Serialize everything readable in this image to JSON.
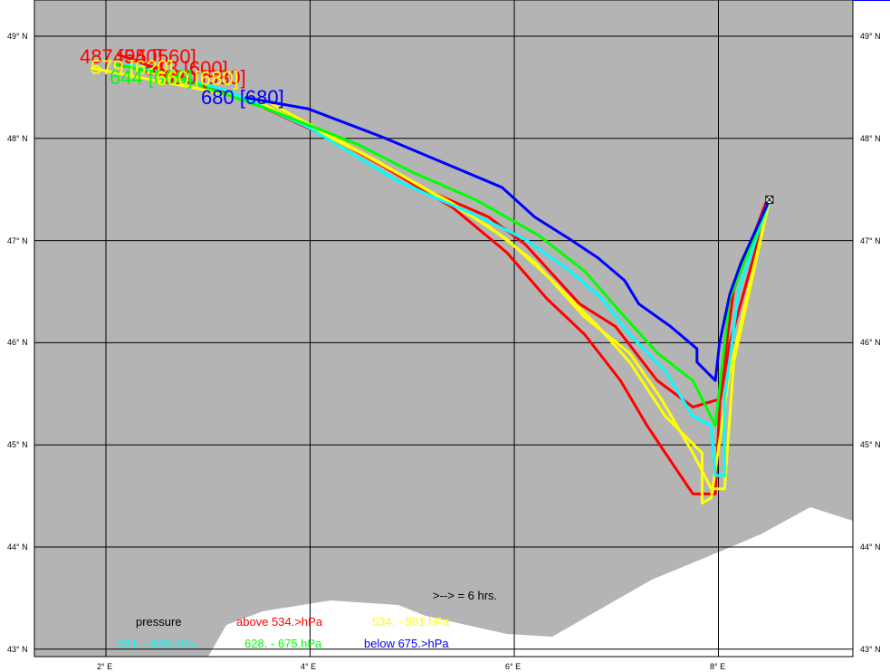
{
  "colors": {
    "ocean": "#b4b4b4",
    "land": "#ffffff",
    "red": "#ff0000",
    "yellow": "#ffff00",
    "green": "#00ff00",
    "cyan": "#00ffff",
    "blue": "#0000ff"
  },
  "axes": {
    "lat_labels": [
      "49° N",
      "48° N",
      "47° N",
      "46° N",
      "45° N",
      "44° N",
      "43° N"
    ],
    "lon_labels": [
      "2° E",
      "4° E",
      "6° E",
      "8° E"
    ]
  },
  "source": {
    "lon": 8.5,
    "lat": 47.4
  },
  "trajectory_labels": [
    "487 [540]",
    "495 [560]",
    "513 [600]",
    "579 [620]",
    "620 [580]",
    "644 [660]",
    "660 [680]",
    "680 [680]"
  ],
  "legend": {
    "time_step": ">--> =  6 hrs.",
    "pressure_title": "pressure",
    "red": "above   534.>hPa",
    "yellow": "534. -    581.hPa",
    "cyan": "581. -    628.hPa",
    "green": "628. -    675.hPa",
    "blue": "below   675.>hPa"
  },
  "trajectories": [
    {
      "color": "red",
      "points": [
        [
          8.5,
          47.4
        ],
        [
          8.46,
          47.36
        ],
        [
          8.15,
          46.52
        ],
        [
          8.02,
          45.54
        ],
        [
          7.97,
          44.52
        ],
        [
          7.75,
          44.52
        ],
        [
          7.48,
          44.92
        ],
        [
          7.3,
          45.19
        ],
        [
          7.04,
          45.63
        ],
        [
          6.69,
          46.08
        ],
        [
          6.32,
          46.43
        ],
        [
          5.93,
          46.88
        ],
        [
          5.4,
          47.32
        ],
        [
          4.51,
          47.85
        ],
        [
          3.62,
          48.29
        ],
        [
          2.12,
          48.82
        ]
      ]
    },
    {
      "color": "red",
      "points": [
        [
          8.5,
          47.4
        ],
        [
          8.11,
          45.99
        ],
        [
          8.02,
          45.45
        ],
        [
          7.75,
          45.37
        ],
        [
          7.4,
          45.63
        ],
        [
          6.99,
          46.16
        ],
        [
          6.64,
          46.38
        ],
        [
          6.11,
          46.96
        ],
        [
          5.75,
          47.23
        ],
        [
          5.13,
          47.5
        ],
        [
          4.33,
          47.94
        ],
        [
          3.18,
          48.47
        ]
      ]
    },
    {
      "color": "yellow",
      "points": [
        [
          8.5,
          47.4
        ],
        [
          8.11,
          45.72
        ],
        [
          7.93,
          44.48
        ],
        [
          7.84,
          44.43
        ],
        [
          7.84,
          44.92
        ],
        [
          7.48,
          45.28
        ],
        [
          7.13,
          45.81
        ],
        [
          6.82,
          46.16
        ],
        [
          6.37,
          46.61
        ],
        [
          5.93,
          47.01
        ],
        [
          5.4,
          47.36
        ],
        [
          4.51,
          47.85
        ],
        [
          3.45,
          48.38
        ],
        [
          1.85,
          48.69
        ]
      ]
    },
    {
      "color": "yellow",
      "points": [
        [
          8.5,
          47.4
        ],
        [
          8.15,
          45.81
        ],
        [
          8.06,
          44.57
        ],
        [
          7.93,
          44.57
        ],
        [
          7.75,
          44.92
        ],
        [
          7.44,
          45.45
        ],
        [
          7.13,
          45.9
        ],
        [
          6.69,
          46.25
        ],
        [
          6.2,
          46.79
        ],
        [
          5.75,
          47.14
        ],
        [
          4.69,
          47.76
        ],
        [
          3.62,
          48.34
        ]
      ]
    },
    {
      "color": "cyan",
      "points": [
        [
          8.5,
          47.4
        ],
        [
          8.2,
          46.52
        ],
        [
          8.06,
          45.45
        ],
        [
          8.06,
          44.7
        ],
        [
          7.97,
          44.7
        ],
        [
          7.93,
          45.19
        ],
        [
          7.75,
          45.28
        ],
        [
          7.48,
          45.72
        ],
        [
          7.13,
          46.08
        ],
        [
          6.86,
          46.43
        ],
        [
          6.55,
          46.7
        ],
        [
          6.11,
          47.01
        ],
        [
          5.66,
          47.23
        ],
        [
          4.86,
          47.58
        ],
        [
          3.98,
          48.11
        ],
        [
          3.18,
          48.47
        ],
        [
          2.2,
          48.73
        ]
      ]
    },
    {
      "color": "green",
      "points": [
        [
          8.5,
          47.4
        ],
        [
          8.11,
          46.43
        ],
        [
          8.02,
          45.63
        ],
        [
          7.97,
          45.19
        ],
        [
          7.75,
          45.63
        ],
        [
          7.4,
          45.9
        ],
        [
          7.04,
          46.3
        ],
        [
          6.69,
          46.7
        ],
        [
          6.24,
          47.05
        ],
        [
          5.62,
          47.4
        ],
        [
          5.0,
          47.67
        ],
        [
          4.47,
          47.94
        ],
        [
          3.58,
          48.29
        ],
        [
          2.69,
          48.6
        ],
        [
          2.07,
          48.73
        ]
      ]
    },
    {
      "color": "blue",
      "points": [
        [
          8.5,
          47.4
        ],
        [
          8.22,
          46.78
        ],
        [
          8.11,
          46.47
        ],
        [
          8.01,
          45.99
        ],
        [
          7.97,
          45.63
        ],
        [
          7.79,
          45.81
        ],
        [
          7.79,
          45.94
        ],
        [
          7.53,
          46.16
        ],
        [
          7.22,
          46.38
        ],
        [
          7.08,
          46.61
        ],
        [
          6.82,
          46.83
        ],
        [
          6.55,
          47.01
        ],
        [
          6.2,
          47.23
        ],
        [
          5.88,
          47.52
        ],
        [
          5.31,
          47.76
        ],
        [
          4.69,
          48.02
        ],
        [
          3.98,
          48.29
        ],
        [
          3.36,
          48.4
        ]
      ]
    }
  ]
}
